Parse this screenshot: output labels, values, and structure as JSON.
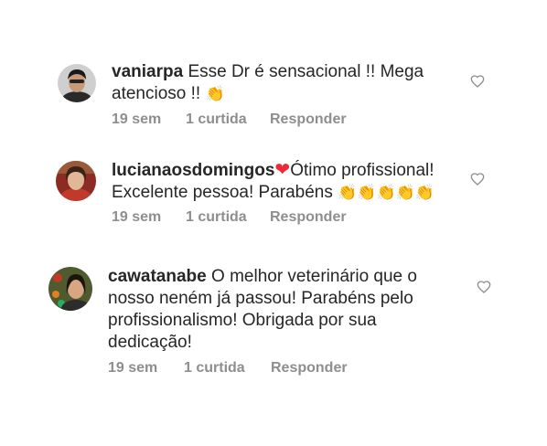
{
  "comments": [
    {
      "username": "vaniarpa",
      "text": "Esse Dr é sensacional !! Mega atencioso !!",
      "emoji": "👏",
      "time": "19 sem",
      "likes": "1 curtida",
      "reply": "Responder"
    },
    {
      "username": "lucianaosdomingos",
      "heart": "❤",
      "text": "Ótimo profissional! Excelente pessoa! Parabéns",
      "emoji": "👏👏👏👏👏",
      "time": "19 sem",
      "likes": "1 curtida",
      "reply": "Responder"
    },
    {
      "username": "cawatanabe",
      "text": "O melhor veterinário que o nosso neném já passou! Parabéns pelo profissionalismo! Obrigada por sua dedicação!",
      "time": "19 sem",
      "likes": "1 curtida",
      "reply": "Responder"
    }
  ],
  "icons": {
    "like": "heart-outline-icon"
  },
  "colors": {
    "text": "#262626",
    "secondary": "#8e8e8e",
    "heart_emoji": "#ed2939"
  }
}
